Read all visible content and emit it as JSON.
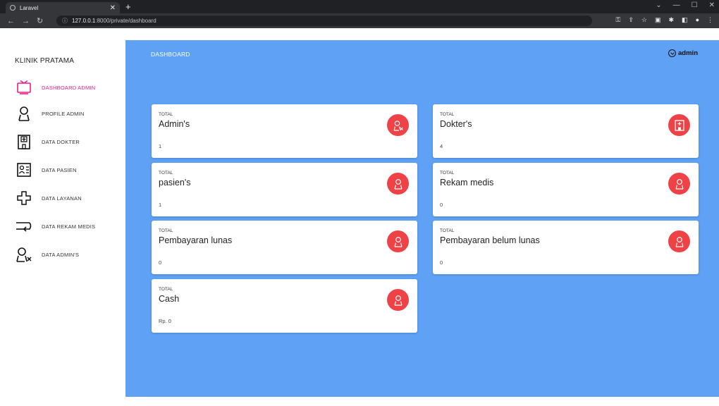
{
  "browser": {
    "tab_title": "Laravel",
    "url_host": "127.0.0.1",
    "url_rest": ":8000/private/dashboard"
  },
  "sidebar": {
    "brand": "KLINIK PRATAMA",
    "items": [
      {
        "label": "DASHBOARD ADMIN",
        "icon": "monitor-icon"
      },
      {
        "label": "PROFILE ADMIN",
        "icon": "user-icon"
      },
      {
        "label": "DATA DOKTER",
        "icon": "hospital-icon"
      },
      {
        "label": "DATA PASIEN",
        "icon": "patient-list-icon"
      },
      {
        "label": "DATA LAYANAN",
        "icon": "medical-cross-icon"
      },
      {
        "label": "DATA REKAM MEDIS",
        "icon": "record-import-icon"
      },
      {
        "label": "DATA ADMIN'S",
        "icon": "user-remove-icon"
      }
    ]
  },
  "header": {
    "title": "DASHBOARD",
    "user": "admin"
  },
  "cards": [
    {
      "small": "TOTAL",
      "name": "Admin's",
      "value": "1"
    },
    {
      "small": "TOTAL",
      "name": "Dokter's",
      "value": "4"
    },
    {
      "small": "TOTAL",
      "name": "pasien's",
      "value": "1"
    },
    {
      "small": "TOTAL",
      "name": "Rekam medis",
      "value": "0"
    },
    {
      "small": "TOTAL",
      "name": "Pembayaran lunas",
      "value": "0"
    },
    {
      "small": "TOTAL",
      "name": "Pembayaran belum lunas",
      "value": "0"
    },
    {
      "small": "TOTAL",
      "name": "Cash",
      "value": "Rp. 0"
    }
  ],
  "colors": {
    "accent": "#e91e8c",
    "main_bg": "#5fa1f5",
    "icon_circle": "#ee4247"
  }
}
